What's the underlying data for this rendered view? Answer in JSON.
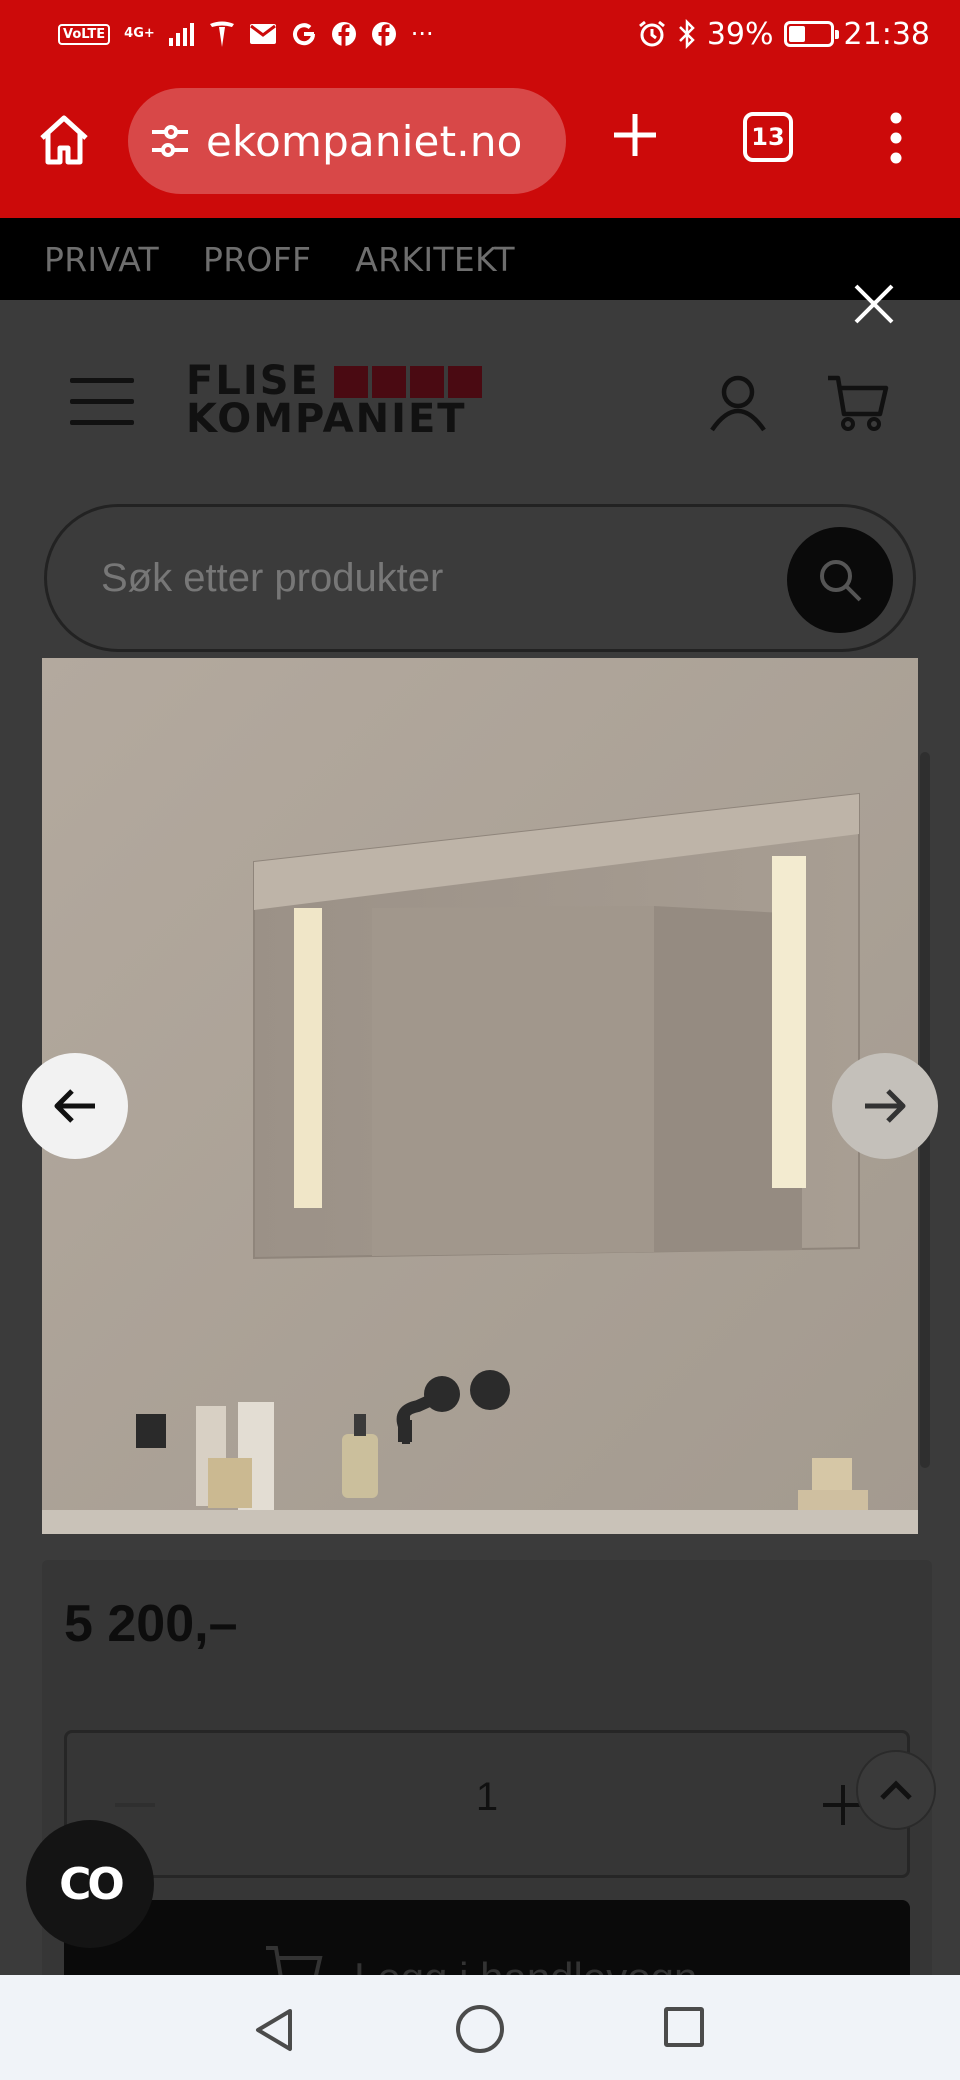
{
  "status_bar": {
    "volte": "VoLTE",
    "network": "4G+",
    "more": "···",
    "battery_percent": "39%",
    "battery_level": 0.39,
    "time": "21:38"
  },
  "browser": {
    "url": "ekompaniet.no",
    "tab_count": "13"
  },
  "site_nav": [
    "PRIVAT",
    "PROFF",
    "ARKITEKT"
  ],
  "header": {
    "logo_line1": "FLISE",
    "logo_line2": "KOMPANIET",
    "logo_brand_color": "#4a0a12"
  },
  "search": {
    "placeholder": "Søk etter produkter"
  },
  "product": {
    "price": "5 200,–",
    "quantity": "1",
    "add_to_cart_label": "Legg i handlevogn"
  },
  "chat": {
    "icon_label": "CO"
  },
  "colors": {
    "browser_red": "#cc0a0a",
    "overlay_dark": "#3b3b3b"
  }
}
